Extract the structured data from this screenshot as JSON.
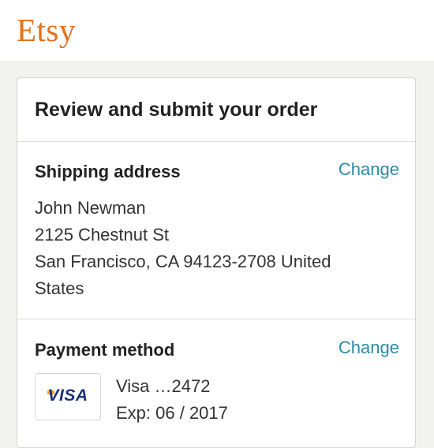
{
  "header": {
    "logo": "Etsy"
  },
  "review": {
    "title": "Review and submit your order",
    "shipping": {
      "heading": "Shipping address",
      "change_label": "Change",
      "lines": [
        "John Newman",
        "2125 Chestnut St",
        "San Francisco, CA 94123-2708 United",
        "States"
      ]
    },
    "payment": {
      "heading": "Payment method",
      "change_label": "Change",
      "card_brand": "VISA",
      "card_label": "Visa …2472",
      "expiry": "Exp: 06 / 2017"
    }
  },
  "colors": {
    "brand": "#e4701e",
    "link": "#2a8ba7",
    "visa_blue": "#1a2f7a",
    "visa_gold": "#f2a51d"
  }
}
